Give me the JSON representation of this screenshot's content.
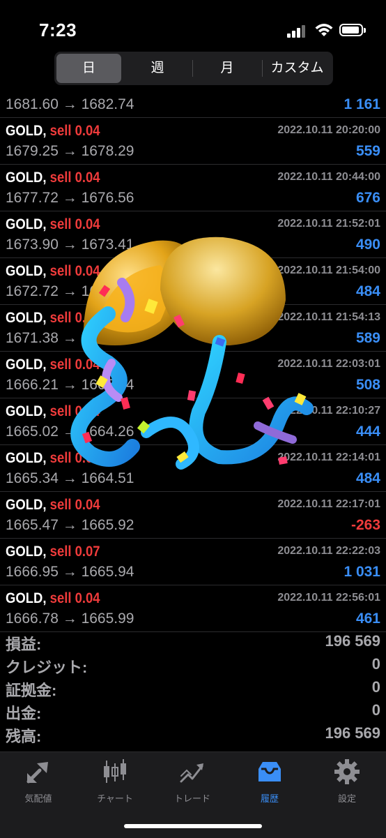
{
  "status": {
    "time": "7:23"
  },
  "segments": [
    {
      "label": "日",
      "active": true
    },
    {
      "label": "週",
      "active": false
    },
    {
      "label": "月",
      "active": false
    },
    {
      "label": "カスタム",
      "active": false
    }
  ],
  "first_row": {
    "price": "1681.60 → 1682.74",
    "profit": "1 161"
  },
  "trades": [
    {
      "symbol": "GOLD,",
      "side": "sell 0.04",
      "date": "2022.10.11 20:20:00",
      "price": "1679.25 → 1678.29",
      "profit": "559"
    },
    {
      "symbol": "GOLD,",
      "side": "sell 0.04",
      "date": "2022.10.11 20:44:00",
      "price": "1677.72 → 1676.56",
      "profit": "676"
    },
    {
      "symbol": "GOLD,",
      "side": "sell 0.04",
      "date": "2022.10.11 21:52:01",
      "price": "1673.90 → 1673.41",
      "profit": "490"
    },
    {
      "symbol": "GOLD,",
      "side": "sell 0.04",
      "date": "2022.10.11 21:54:00",
      "price": "1672.72 → 1672.23",
      "profit": "484"
    },
    {
      "symbol": "GOLD,",
      "side": "sell 0.04",
      "date": "2022.10.11 21:54:13",
      "price": "1671.38 → 1670.78",
      "profit": "589"
    },
    {
      "symbol": "GOLD,",
      "side": "sell 0.04",
      "date": "2022.10.11 22:03:01",
      "price": "1666.21 → 1665.34",
      "profit": "508"
    },
    {
      "symbol": "GOLD,",
      "side": "sell 0.04",
      "date": "2022.10.11 22:10:27",
      "price": "1665.02 → 1664.26",
      "profit": "444"
    },
    {
      "symbol": "GOLD,",
      "side": "sell 0.04",
      "date": "2022.10.11 22:14:01",
      "price": "1665.34 → 1664.51",
      "profit": "484"
    },
    {
      "symbol": "GOLD,",
      "side": "sell 0.04",
      "date": "2022.10.11 22:17:01",
      "price": "1665.47 → 1665.92",
      "profit": "-263"
    },
    {
      "symbol": "GOLD,",
      "side": "sell 0.07",
      "date": "2022.10.11 22:22:03",
      "price": "1666.95 → 1665.94",
      "profit": "1 031"
    },
    {
      "symbol": "GOLD,",
      "side": "sell 0.04",
      "date": "2022.10.11 22:56:01",
      "price": "1666.78 → 1665.99",
      "profit": "461"
    }
  ],
  "summary": [
    {
      "label": "損益:",
      "value": "196 569"
    },
    {
      "label": "クレジット:",
      "value": "0"
    },
    {
      "label": "証拠金:",
      "value": "0"
    },
    {
      "label": "出金:",
      "value": "0"
    },
    {
      "label": "残高:",
      "value": "196 569"
    }
  ],
  "tabs": [
    {
      "label": "気配値",
      "icon": "quotes-icon",
      "active": false
    },
    {
      "label": "チャート",
      "icon": "chart-icon",
      "active": false
    },
    {
      "label": "トレード",
      "icon": "trade-icon",
      "active": false
    },
    {
      "label": "履歴",
      "icon": "history-inbox-icon",
      "active": true
    },
    {
      "label": "設定",
      "icon": "gear-icon",
      "active": false
    }
  ],
  "colors": {
    "profit": "#3a8ef6",
    "loss": "#ef3b3b",
    "sell": "#ef3b3b",
    "active_tab": "#3a8ef6"
  }
}
